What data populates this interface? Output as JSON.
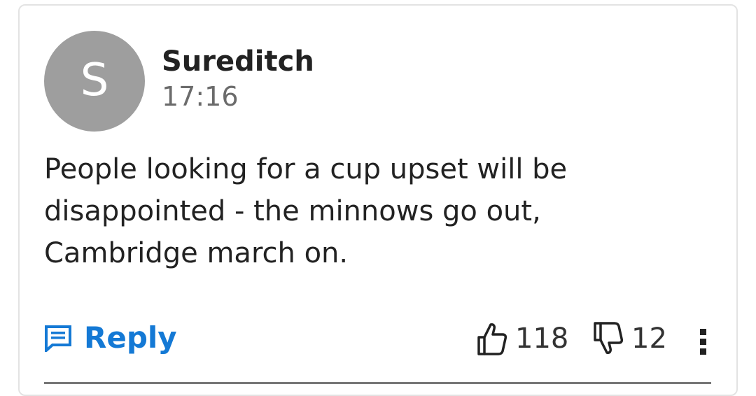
{
  "comment": {
    "author": {
      "initial": "S",
      "name": "Sureditch",
      "avatar_color": "#9e9e9e"
    },
    "timestamp": "17:16",
    "body_lines": [
      "People looking for a cup upset will be",
      "disappointed - the minnows go out,",
      "Cambridge march on."
    ]
  },
  "actions": {
    "reply_label": "Reply",
    "reply_icon": "comment-lines-icon",
    "like_icon": "thumbs-up-icon",
    "like_count": "118",
    "dislike_icon": "thumbs-down-icon",
    "dislike_count": "12",
    "more_icon": "vertical-ellipsis-icon"
  },
  "colors": {
    "accent": "#1479d5",
    "text": "#222222",
    "muted": "#6b6b6b"
  }
}
